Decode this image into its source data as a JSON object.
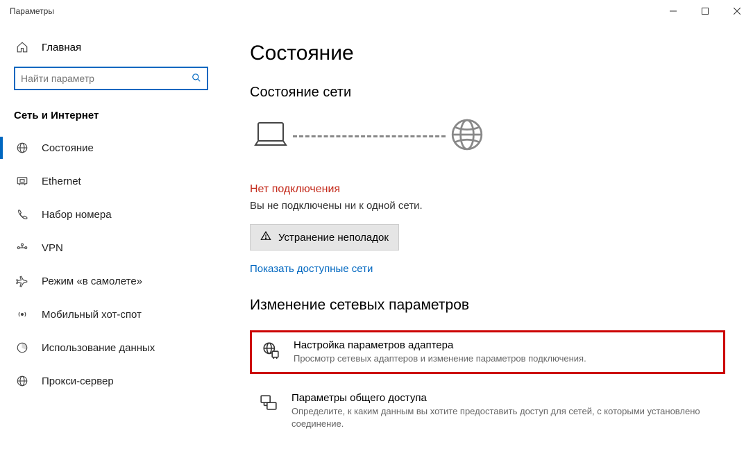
{
  "window": {
    "title": "Параметры"
  },
  "sidebar": {
    "home": "Главная",
    "search_placeholder": "Найти параметр",
    "group": "Сеть и Интернет",
    "items": [
      {
        "label": "Состояние"
      },
      {
        "label": "Ethernet"
      },
      {
        "label": "Набор номера"
      },
      {
        "label": "VPN"
      },
      {
        "label": "Режим «в самолете»"
      },
      {
        "label": "Мобильный хот-спот"
      },
      {
        "label": "Использование данных"
      },
      {
        "label": "Прокси-сервер"
      }
    ]
  },
  "main": {
    "title": "Состояние",
    "network_status_title": "Состояние сети",
    "no_connection": "Нет подключения",
    "no_connection_sub": "Вы не подключены ни к одной сети.",
    "troubleshoot": "Устранение неполадок",
    "show_networks": "Показать доступные сети",
    "change_settings_title": "Изменение сетевых параметров",
    "adapter": {
      "title": "Настройка параметров адаптера",
      "desc": "Просмотр сетевых адаптеров и изменение параметров подключения."
    },
    "sharing": {
      "title": "Параметры общего доступа",
      "desc": "Определите, к каким данным вы хотите предоставить доступ для сетей, с которыми установлено соединение."
    }
  }
}
